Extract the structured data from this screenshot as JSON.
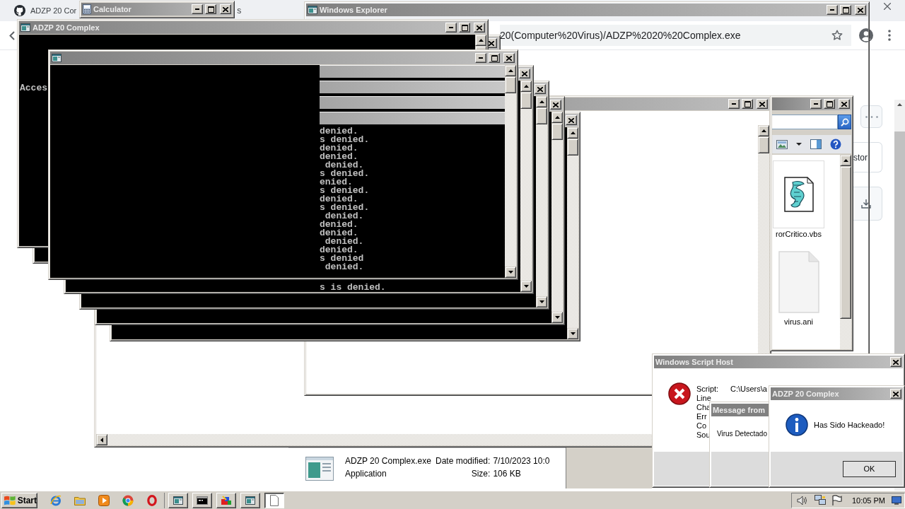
{
  "browser": {
    "tab_title": "ADZP 20 Cor",
    "tab_title_fragment": "s",
    "address": "20(Computer%20Virus)/ADZP%2020%20Complex.exe",
    "side_text": "stor"
  },
  "explorer_window": {
    "title": "Windows Explorer"
  },
  "file_window": {
    "files": [
      {
        "name": "rorCritico.vbs",
        "kind": "script",
        "selected": true
      },
      {
        "name": "virus.ani",
        "kind": "blank",
        "selected": false
      }
    ]
  },
  "details_pane": {
    "file_name": "ADZP 20 Complex.exe",
    "file_type": "Application",
    "modified_label": "Date modified:",
    "modified": "7/10/2023 10:0",
    "size_label": "Size:",
    "size": "106 KB"
  },
  "calculator": {
    "title": "Calculator"
  },
  "consoles": [
    {
      "kind": "stacked"
    },
    {
      "kind": "stacked"
    },
    {
      "kind": "stacked"
    },
    {
      "kind": "stacked_text",
      "lines": [
        "s is denied."
      ]
    },
    {
      "kind": "edge"
    },
    {
      "kind": "titled",
      "title": "ADZP 20 Complex",
      "lines": [
        "Acces"
      ]
    },
    {
      "kind": "split",
      "lines": [
        "denied.",
        "s denied.",
        "denied.",
        "denied.",
        " denied.",
        "s denied.",
        "enied.",
        "s denied.",
        "denied.",
        "s denied.",
        " denied.",
        "denied.",
        "denied.",
        " denied.",
        "denied.",
        "s denied",
        " denied."
      ]
    }
  ],
  "script_host": {
    "title": "Windows Script Host",
    "fields": [
      {
        "label": "Script:",
        "value": "C:\\Users\\a"
      },
      {
        "label": "Line"
      },
      {
        "label": "Cha"
      },
      {
        "label": "Err"
      },
      {
        "label": "Co"
      },
      {
        "label": "Sou"
      }
    ]
  },
  "message_box": {
    "title": "Message from",
    "text": "Virus Detectado"
  },
  "alert_dialog": {
    "title": "ADZP 20 Complex",
    "text": "Has Sido Hackeado!",
    "ok": "OK"
  },
  "taskbar": {
    "start": "Start",
    "quick_launch": [
      {
        "kind": "globe"
      },
      {
        "kind": "folder"
      },
      {
        "kind": "media"
      },
      {
        "kind": "wheel"
      },
      {
        "kind": "ring"
      }
    ],
    "tasks": [
      {
        "kind": "window",
        "selected": false
      },
      {
        "kind": "console",
        "selected": false
      },
      {
        "kind": "paint",
        "selected": false
      },
      {
        "kind": "window",
        "selected": false
      },
      {
        "kind": "page",
        "selected": true
      }
    ],
    "clock": "10:05 PM"
  }
}
